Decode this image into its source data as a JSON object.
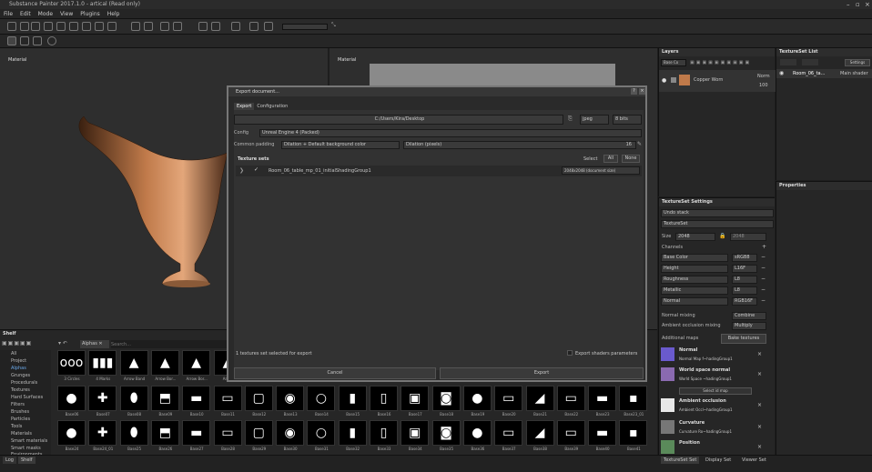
{
  "window": {
    "title": "Substance Painter 2017.1.0 - artical (Read only)"
  },
  "menu": [
    "File",
    "Edit",
    "Mode",
    "View",
    "Plugins",
    "Help"
  ],
  "viewports": {
    "left_label": "Material",
    "right_label": "Material"
  },
  "shelf": {
    "title": "Shelf",
    "filter_tag": "Alphas",
    "search_placeholder": "Search...",
    "categories": [
      "All",
      "Project",
      "Alphas",
      "Grunges",
      "Procedurals",
      "Textures",
      "Hard Surfaces",
      "Filters",
      "Brushes",
      "Particles",
      "Tools",
      "Materials",
      "Smart materials",
      "Smart masks",
      "Environments"
    ],
    "row1": [
      "3 Circles",
      "4 Marks",
      "Arrow Band",
      "Arrow Bor...",
      "Arrow Bor...",
      "Arrow"
    ],
    "row2": [
      "Base06",
      "Base07",
      "Base08",
      "Base09",
      "Base10",
      "Base11",
      "Base12",
      "Base13",
      "Base14",
      "Base15",
      "Base16",
      "Base17",
      "Base18",
      "Base19",
      "Base20",
      "Base21",
      "Base22",
      "Base23",
      "Base23_01"
    ],
    "row3": [
      "Base24",
      "Base24_01",
      "Base25",
      "Base26",
      "Base27",
      "Base28",
      "Base29",
      "Base30",
      "Base31",
      "Base32",
      "Base33",
      "Base34",
      "Base35",
      "Base36",
      "Base37",
      "Base38",
      "Base39",
      "Base40",
      "Base41"
    ]
  },
  "layers": {
    "title": "Layers",
    "blend": "Base Co",
    "layer_name": "Copper Worn",
    "blend_mode": "Norm",
    "opacity": "100"
  },
  "textureset_list": {
    "title": "TextureSet List",
    "settings_btn": "Settings",
    "item": "Room_06_ta...",
    "shader": "Main shader"
  },
  "properties": {
    "title": "Properties"
  },
  "tss": {
    "title": "TextureSet Settings",
    "undo": "Undo stack",
    "textureset": "TextureSet",
    "size_label": "Size",
    "size": "2048",
    "size2": "2048",
    "channels_label": "Channels",
    "channels": [
      {
        "name": "Base Color",
        "fmt": "sRGB8"
      },
      {
        "name": "Height",
        "fmt": "L16F"
      },
      {
        "name": "Roughness",
        "fmt": "L8"
      },
      {
        "name": "Metallic",
        "fmt": "L8"
      },
      {
        "name": "Normal",
        "fmt": "RGB16F"
      }
    ],
    "normal_mixing_label": "Normal mixing",
    "normal_mixing": "Combine",
    "ao_mixing_label": "Ambient occlusion mixing",
    "ao_mixing": "Multiply",
    "additional_maps_label": "Additional maps",
    "bake_btn": "Bake textures",
    "maps": [
      {
        "name": "Normal",
        "sub": "Normal Map f~hadingGroup1",
        "color": "#6a5acd"
      },
      {
        "name": "World space normal",
        "sub": "World Space ~hadingGroup1",
        "color": "#8a6ab0"
      },
      {
        "name": "Ambient occlusion",
        "sub": "Ambient Occl~hadingGroup1",
        "color": "#e8e8e8"
      },
      {
        "name": "Curvature",
        "sub": "Curvature Ro~hadingGroup1",
        "color": "#777777"
      },
      {
        "name": "Position",
        "sub": "",
        "color": "#5a8a5a"
      }
    ],
    "select_id_map": "Select id map"
  },
  "bottom_tabs": [
    "TextureSet Set",
    "Display Set",
    "Viewer Set"
  ],
  "status_tabs": [
    "Log",
    "Shelf"
  ],
  "dialog": {
    "title": "Export document...",
    "tabs": [
      "Export",
      "Configuration"
    ],
    "path": "C:/Users/Kira/Desktop",
    "format": "jpeg",
    "bits": "8 bits",
    "config_label": "Config",
    "config": "Unreal Engine 4 (Packed)",
    "padding_label": "Common padding",
    "padding": "Dilation + Default background color",
    "dilation_label": "Dilation (pixels)",
    "dilation": "16",
    "texture_sets_label": "Texture sets",
    "select_label": "Select",
    "all_btn": "All",
    "none_btn": "None",
    "set_name": "Room_06_table_mp_01_initialShadingGroup1",
    "set_size": "2048x2048 (document size)",
    "selected_count": "1 textures set selected for export",
    "export_shaders": "Export shaders parameters",
    "cancel": "Cancel",
    "export": "Export"
  }
}
